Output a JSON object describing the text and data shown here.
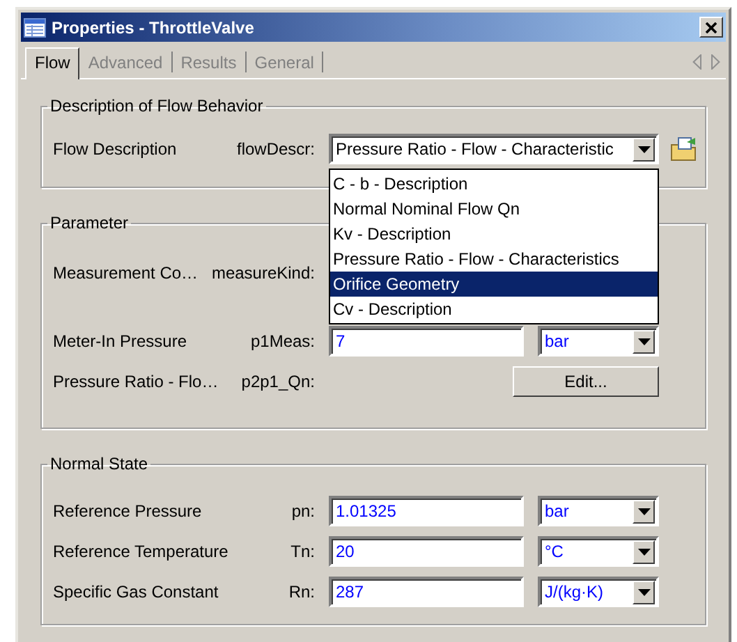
{
  "window": {
    "title": "Properties - ThrottleValve"
  },
  "tabs": [
    {
      "label": "Flow",
      "selected": true
    },
    {
      "label": "Advanced",
      "selected": false
    },
    {
      "label": "Results",
      "selected": false
    },
    {
      "label": "General",
      "selected": false
    }
  ],
  "groups": [
    {
      "title": "Description of Flow Behavior",
      "rows": [
        {
          "kind": "combo",
          "label": "Flow Description",
          "param": "flowDescr:",
          "value": "Pressure Ratio - Flow - Characteristic",
          "dropdown": [
            {
              "label": "C - b - Description",
              "selected": false
            },
            {
              "label": "Normal Nominal Flow Qn",
              "selected": false
            },
            {
              "label": "Kv - Description",
              "selected": false
            },
            {
              "label": "Pressure Ratio - Flow - Characteristics",
              "selected": false
            },
            {
              "label": "Orifice Geometry",
              "selected": true
            },
            {
              "label": "Cv - Description",
              "selected": false
            }
          ]
        }
      ]
    },
    {
      "title": "Parameter",
      "rows": [
        {
          "kind": "covered",
          "label": "Measurement Co…",
          "param": "measureKind:"
        },
        {
          "kind": "value",
          "label": "Meter-In Pressure",
          "param": "p1Meas:",
          "value": "7",
          "unit": "bar"
        },
        {
          "kind": "button",
          "label": "Pressure Ratio - Flo…",
          "param": "p2p1_Qn:",
          "button": "Edit..."
        }
      ]
    },
    {
      "title": "Normal State",
      "rows": [
        {
          "kind": "value",
          "label": "Reference Pressure",
          "param": "pn:",
          "value": "1.01325",
          "unit": "bar"
        },
        {
          "kind": "value",
          "label": "Reference Temperature",
          "param": "Tn:",
          "value": "20",
          "unit": "°C"
        },
        {
          "kind": "value",
          "label": "Specific Gas Constant",
          "param": "Rn:",
          "value": "287",
          "unit": "J/(kg·K)"
        }
      ]
    }
  ]
}
